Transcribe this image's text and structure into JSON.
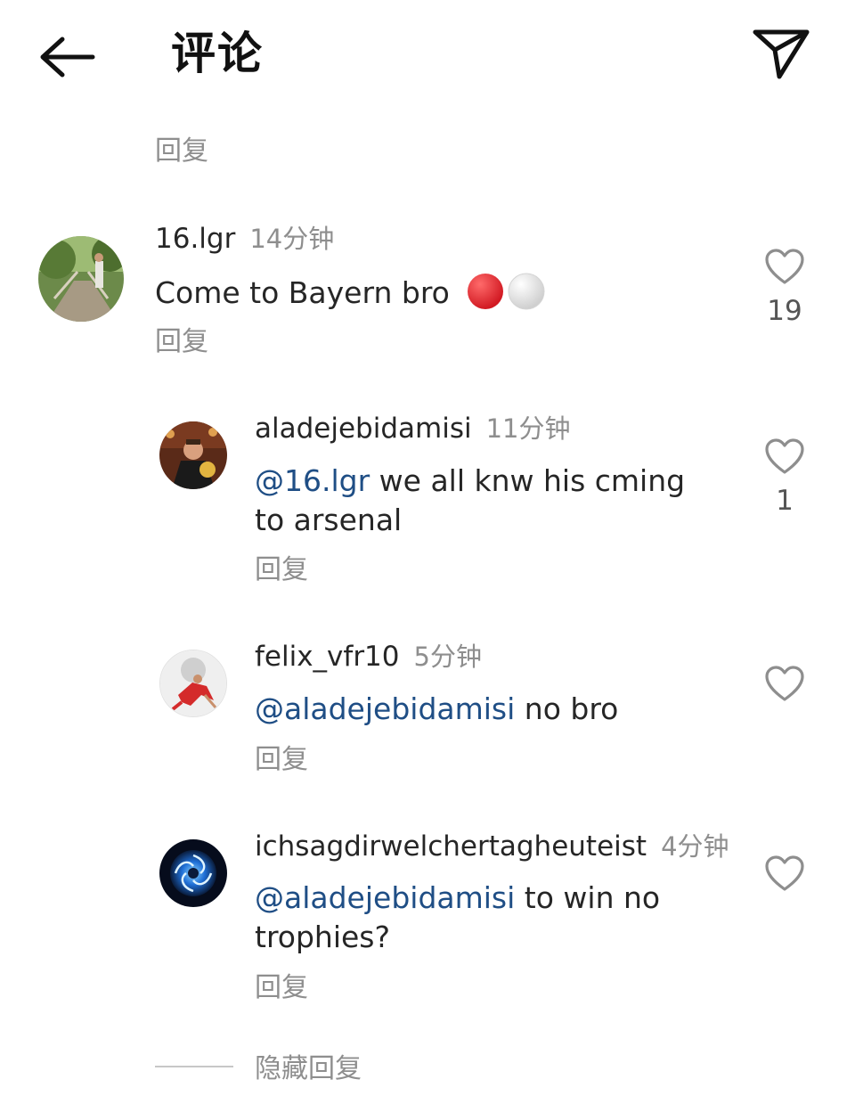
{
  "header": {
    "title": "评论"
  },
  "top_reply_label": "回复",
  "comments": [
    {
      "username": "16.lgr",
      "time": "14分钟",
      "text": "Come to Bayern bro",
      "emoji": [
        "red-circle",
        "white-circle"
      ],
      "reply_label": "回复",
      "likes": "19"
    }
  ],
  "replies": [
    {
      "username": "aladejebidamisi",
      "time": "11分钟",
      "mention": "@16.lgr",
      "text_line1": " we all knw his cming",
      "text_line2": "to arsenal",
      "reply_label": "回复",
      "likes": "1"
    },
    {
      "username": "felix_vfr10",
      "time": "5分钟",
      "mention": "@aladejebidamisi",
      "text_line1": " no bro",
      "reply_label": "回复",
      "likes": ""
    },
    {
      "username": "ichsagdirwelchertagheuteist",
      "time": "4分钟",
      "mention": "@aladejebidamisi",
      "text_line1": " to win no",
      "text_line2": "trophies?",
      "reply_label": "回复",
      "likes": ""
    }
  ],
  "hide_replies_label": "隐藏回复",
  "colors": {
    "mention": "#1f4e85",
    "secondary_text": "#8e8e8e",
    "emoji_red": "#e0202a"
  }
}
